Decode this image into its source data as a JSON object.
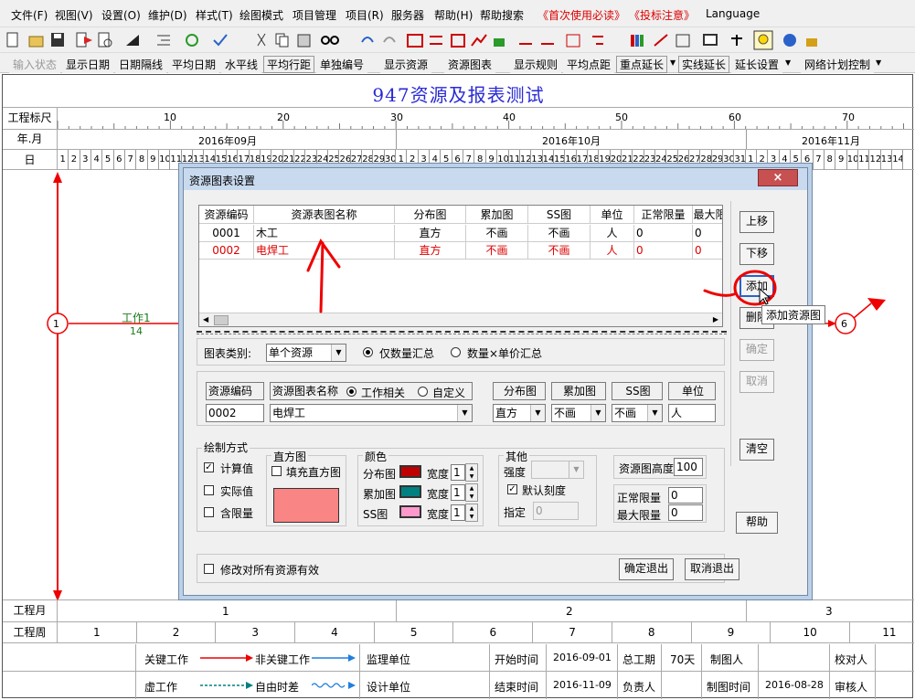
{
  "menu": [
    "文件(F)",
    "视图(V)",
    "设置(O)",
    "维护(D)",
    "样式(T)",
    "绘图模式",
    "项目管理",
    "项目(R)",
    "服务器",
    "帮助(H)",
    "帮助搜索",
    "《首次使用必读》",
    "《投标注意》",
    "Language"
  ],
  "toolbar2": [
    "输入状态",
    "显示日期",
    "日期隔线",
    "平均日期",
    "水平线",
    "平均行距",
    "单独编号",
    "显示资源",
    "资源图表",
    "显示规则",
    "平均点距",
    "重点延长",
    "实线延长",
    "延长设置",
    "网络计划控制"
  ],
  "chart_title": "947资源及报表测试",
  "scale": {
    "label_ruler": "工程标尺",
    "label_month": "年.月",
    "label_day": "日",
    "ruler_ticks": [
      "10",
      "20",
      "30",
      "40",
      "50",
      "60",
      "70"
    ],
    "months": [
      "2016年09月",
      "2016年10月",
      "2016年11月"
    ]
  },
  "network": {
    "node_start": "1",
    "node_end": "6",
    "work_name": "工作1",
    "work_duration": "14"
  },
  "dialog": {
    "title": "资源图表设置",
    "close": "×",
    "columns": [
      "资源编码",
      "资源表图名称",
      "分布图",
      "累加图",
      "SS图",
      "单位",
      "正常限量",
      "最大限量"
    ],
    "rows": [
      [
        "0001",
        "木工",
        "直方",
        "不画",
        "不画",
        "人",
        "0",
        "0"
      ],
      [
        "0002",
        "电焊工",
        "直方",
        "不画",
        "不画",
        "人",
        "0",
        "0"
      ]
    ],
    "side_buttons": {
      "up": "上移",
      "down": "下移",
      "add": "添加",
      "delete": "删除",
      "confirm": "确定",
      "cancel": "取消",
      "clear": "清空",
      "help": "帮助"
    },
    "tooltip": "添加资源图",
    "chart_type_label": "图表类别:",
    "chart_type_value": "单个资源",
    "radio_qty": "仅数量汇总",
    "radio_qty_price": "数量×单价汇总",
    "form_headers": {
      "code": "资源编码",
      "name": "资源图表名称",
      "radio_work": "工作相关",
      "radio_custom": "自定义",
      "dist": "分布图",
      "cumu": "累加图",
      "ss": "SS图",
      "unit": "单位"
    },
    "form_values": {
      "code": "0002",
      "name": "电焊工",
      "dist": "直方",
      "cumu": "不画",
      "ss": "不画",
      "unit": "人"
    },
    "draw_mode": {
      "title": "绘制方式",
      "calc": "计算值",
      "actual": "实际值",
      "limit": "含限量"
    },
    "histogram": {
      "title": "直方图",
      "fill": "填充直方图",
      "color": "#f98585"
    },
    "colors": {
      "title": "颜色",
      "dist_label": "分布图",
      "cumu_label": "累加图",
      "ss_label": "SS图",
      "width_label": "宽度",
      "dist_color": "#c00000",
      "cumu_color": "#008080",
      "ss_color": "#ff99cc",
      "dist_width": "1",
      "cumu_width": "1",
      "ss_width": "1"
    },
    "other": {
      "title": "其他",
      "intensity": "强度",
      "default_scale": "默认刻度",
      "specify": "指定",
      "specify_value": "0"
    },
    "height": {
      "label": "资源图高度",
      "value": "100"
    },
    "limits": {
      "normal_label": "正常限量",
      "normal_value": "0",
      "max_label": "最大限量",
      "max_value": "0"
    },
    "apply_all": "修改对所有资源有效",
    "ok_exit": "确定退出",
    "cancel_exit": "取消退出"
  },
  "footer": {
    "month_label": "工程月",
    "months": [
      "1",
      "2",
      "3"
    ],
    "week_label": "工程周",
    "weeks": [
      "1",
      "2",
      "3",
      "4",
      "5",
      "6",
      "7",
      "8",
      "9",
      "10",
      "11"
    ],
    "legend": {
      "critical": "关键工作",
      "noncritical": "非关键工作",
      "virtual": "虚工作",
      "float": "自由时差"
    },
    "info": {
      "supervisor": "监理单位",
      "designer": "设计单位",
      "start_label": "开始时间",
      "start": "2016-09-01",
      "end_label": "结束时间",
      "end": "2016-11-09",
      "period_label": "总工期",
      "period": "70天",
      "owner_label": "负责人",
      "drawer_label": "制图人",
      "draw_time_label": "制图时间",
      "draw_time": "2016-08-28",
      "checker_label": "校对人",
      "approver_label": "审核人"
    }
  }
}
